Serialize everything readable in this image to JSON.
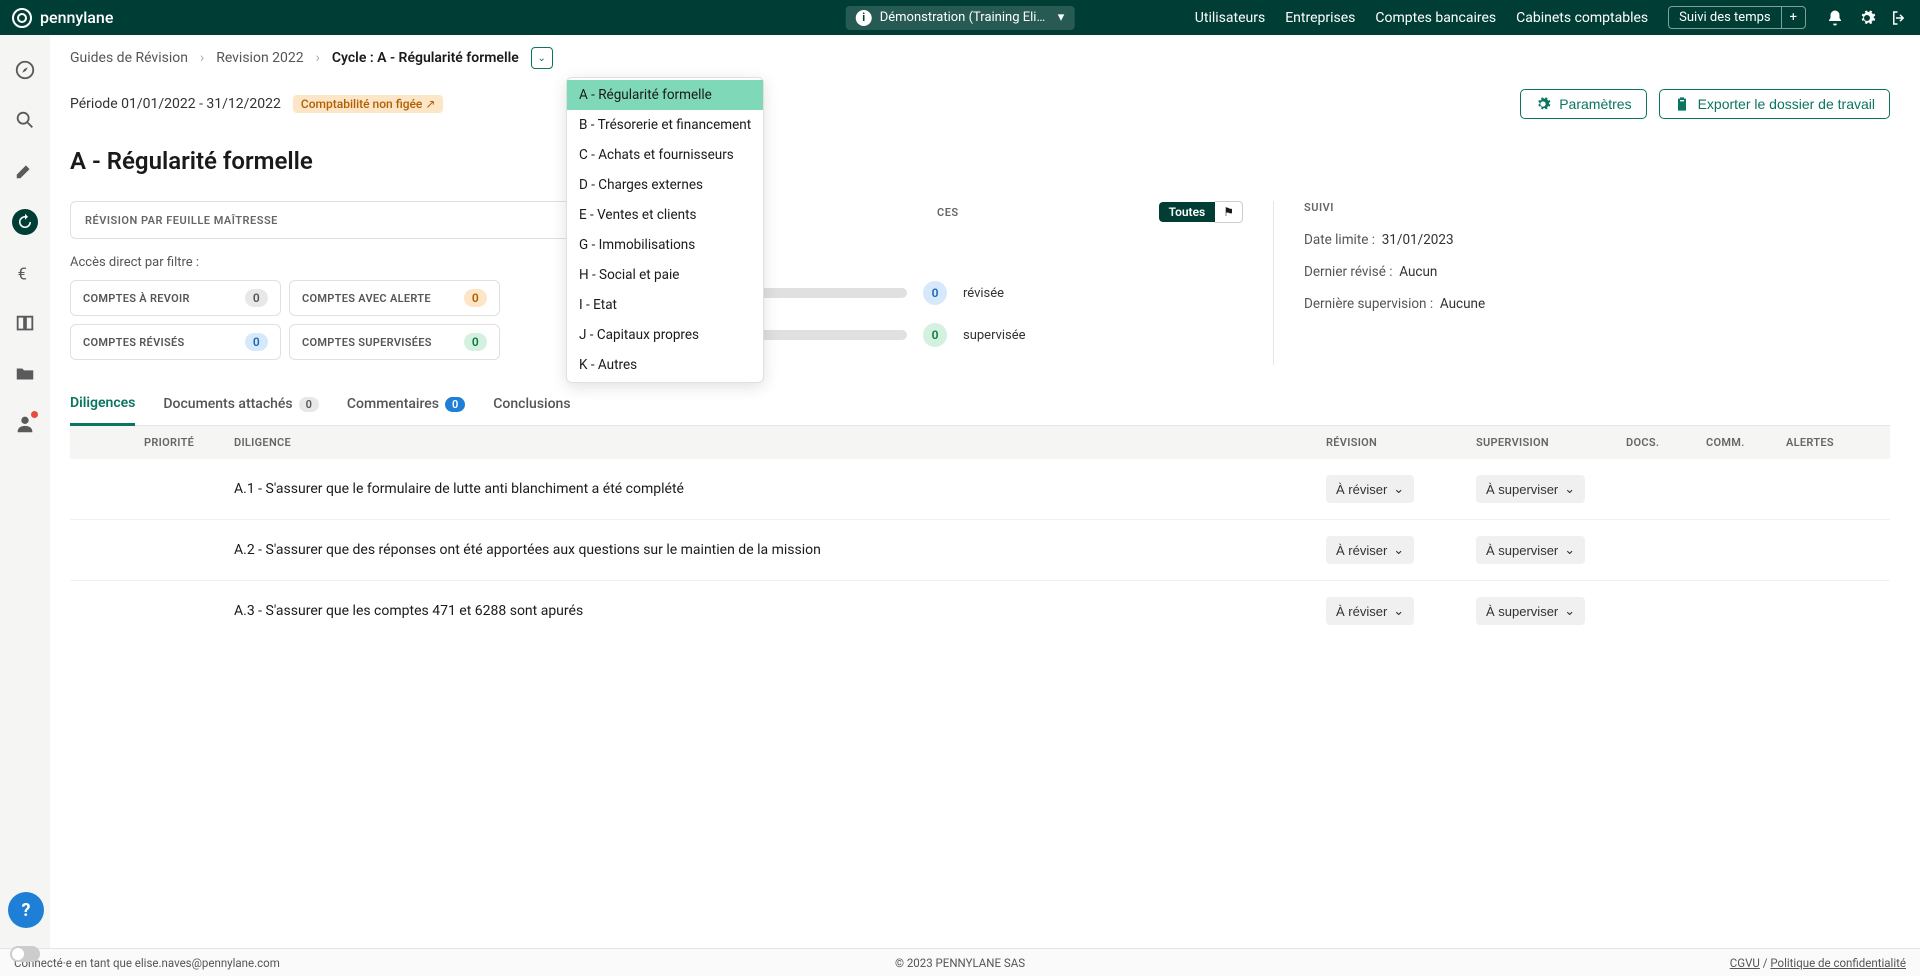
{
  "brand": "pennylane",
  "demo_label": "Démonstration (Training Elis…",
  "topnav": {
    "users": "Utilisateurs",
    "companies": "Entreprises",
    "bank_accounts": "Comptes bancaires",
    "firms": "Cabinets comptables",
    "time_tracking": "Suivi des temps"
  },
  "breadcrumb": {
    "l1": "Guides de Révision",
    "l2": "Revision 2022",
    "l3": "Cycle : A - Régularité formelle"
  },
  "cycle_dropdown": [
    "A - Régularité formelle",
    "B - Trésorerie et financement",
    "C - Achats et fournisseurs",
    "D - Charges externes",
    "E - Ventes et clients",
    "G - Immobilisations",
    "H - Social et paie",
    "I - Etat",
    "J - Capitaux propres",
    "K - Autres"
  ],
  "period": "Période 01/01/2022 - 31/12/2022",
  "accounting_status": "Comptabilité non figée ↗",
  "actions": {
    "params": "Paramètres",
    "export": "Exporter le dossier de travail"
  },
  "cycle_title": "A - Régularité formelle",
  "panel_revision": {
    "label": "RÉVISION PAR FEUILLE MAÎTRESSE",
    "filter_label": "Accès direct par filtre :",
    "chips": {
      "to_review": "COMPTES À REVOIR",
      "to_review_n": "0",
      "alert": "COMPTES AVEC ALERTE",
      "alert_n": "0",
      "reviewed": "COMPTES RÉVISÉS",
      "reviewed_n": "0",
      "supervised": "COMPTES SUPERVISÉES",
      "supervised_n": "0"
    }
  },
  "panel_diligences": {
    "label": "CES",
    "toutes": "Toutes",
    "revised_n": "0",
    "revised": "révisée",
    "supervised_n": "0",
    "supervised": "supervisée"
  },
  "panel_suivi": {
    "label": "SUIVI",
    "deadline_k": "Date limite :",
    "deadline_v": "31/01/2023",
    "last_rev_k": "Dernier révisé :",
    "last_rev_v": "Aucun",
    "last_sup_k": "Dernière supervision :",
    "last_sup_v": "Aucune"
  },
  "tabs": {
    "diligences": "Diligences",
    "docs": "Documents attachés",
    "docs_n": "0",
    "comments": "Commentaires",
    "comments_n": "0",
    "conclusions": "Conclusions"
  },
  "table": {
    "h_priority": "PRIORITÉ",
    "h_diligence": "DILIGENCE",
    "h_revision": "RÉVISION",
    "h_supervision": "SUPERVISION",
    "h_docs": "DOCS.",
    "h_comm": "COMM.",
    "h_alerts": "ALERTES",
    "rows": [
      {
        "text": "A.1 - S'assurer que le formulaire de lutte anti blanchiment a été complété",
        "rev": "À réviser",
        "sup": "À superviser"
      },
      {
        "text": "A.2 - S'assurer que des réponses ont été apportées aux questions sur le maintien de la mission",
        "rev": "À réviser",
        "sup": "À superviser"
      },
      {
        "text": "A.3 - S'assurer que les comptes 471 et 6288 sont apurés",
        "rev": "À réviser",
        "sup": "À superviser"
      }
    ]
  },
  "footer": {
    "left": "Connecté·e en tant que elise.naves@pennylane.com",
    "center": "© 2023 PENNYLANE SAS",
    "cgvu": "CGVU",
    "sep": " / ",
    "privacy": "Politique de confidentialité"
  }
}
